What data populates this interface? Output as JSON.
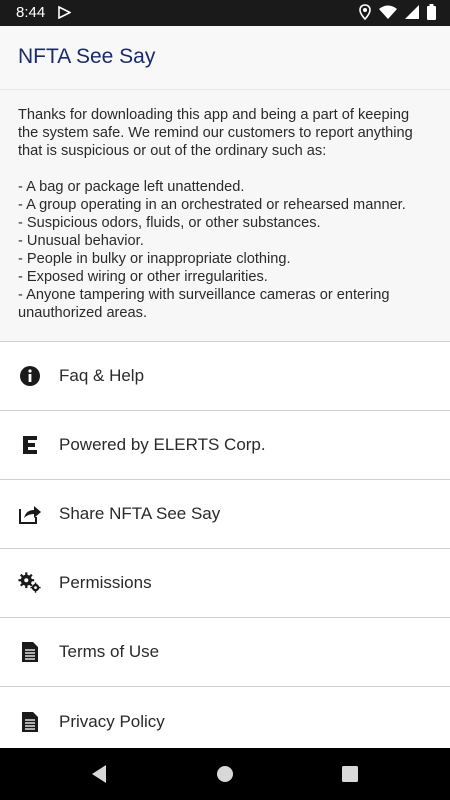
{
  "status_bar": {
    "time": "8:44",
    "icons": [
      "play-store-icon",
      "location-icon",
      "wifi-icon",
      "signal-icon",
      "battery-icon"
    ]
  },
  "app_bar": {
    "title": "NFTA See Say"
  },
  "intro": {
    "paragraph": "Thanks for downloading this app and being a part of keeping the system safe. We remind our customers to report anything that is suspicious or out of the ordinary such as:",
    "items": [
      "- A bag or package left unattended.",
      "- A group operating in an orchestrated or rehearsed manner.",
      "- Suspicious odors, fluids, or other substances.",
      "- Unusual behavior.",
      "- People in bulky or inappropriate clothing.",
      "- Exposed wiring or other irregularities.",
      "- Anyone tampering with surveillance cameras or entering unauthorized areas."
    ]
  },
  "menu": {
    "items": [
      {
        "label": "Faq & Help",
        "icon": "info-icon"
      },
      {
        "label": "Powered by ELERTS Corp.",
        "icon": "elerts-logo-icon"
      },
      {
        "label": "Share NFTA See Say",
        "icon": "share-icon"
      },
      {
        "label": "Permissions",
        "icon": "gear-icon"
      },
      {
        "label": "Terms of Use",
        "icon": "document-icon"
      },
      {
        "label": "Privacy Policy",
        "icon": "document-icon"
      }
    ]
  },
  "nav_bar": {
    "buttons": [
      "back-icon",
      "home-icon",
      "recents-icon"
    ]
  },
  "colors": {
    "title": "#1a2b6b",
    "status_bar": "#1a1a1a",
    "nav_bar": "#000000"
  }
}
